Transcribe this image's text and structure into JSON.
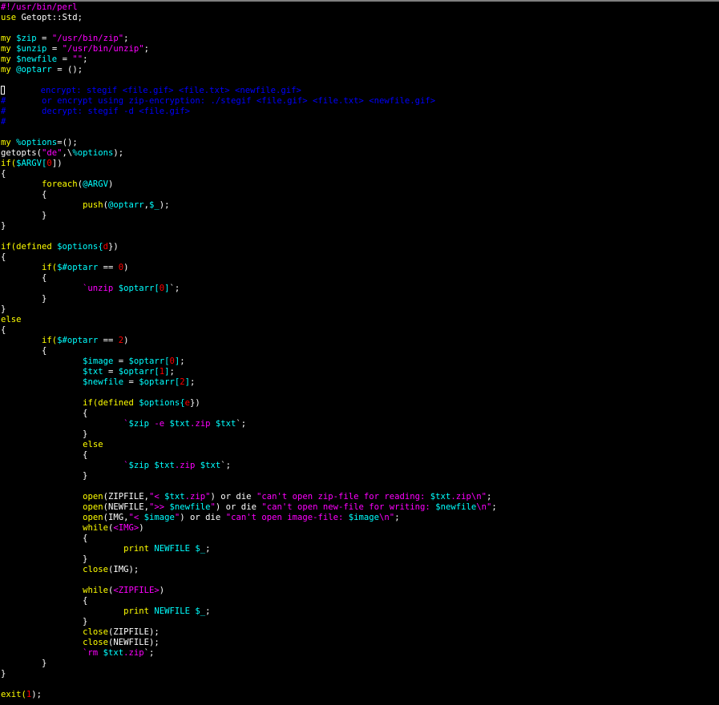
{
  "editor": {
    "palette": {
      "text": "#ffffff",
      "keyword": "#ffff00",
      "string": "#ff00ff",
      "comment": "#0000ff",
      "variable": "#00ffff",
      "number": "#ff0000",
      "builtin": "#00ffff"
    },
    "lines": [
      [
        {
          "t": "#!/usr/bin/perl",
          "c": "string"
        }
      ],
      [
        {
          "t": "use",
          "c": "keyword"
        },
        {
          "t": " Getopt::Std;",
          "c": "text"
        }
      ],
      [],
      [
        {
          "t": "my",
          "c": "keyword"
        },
        {
          "t": " ",
          "c": "text"
        },
        {
          "t": "$zip",
          "c": "variable"
        },
        {
          "t": " = ",
          "c": "text"
        },
        {
          "t": "\"/usr/bin/zip\"",
          "c": "string"
        },
        {
          "t": ";",
          "c": "text"
        }
      ],
      [
        {
          "t": "my",
          "c": "keyword"
        },
        {
          "t": " ",
          "c": "text"
        },
        {
          "t": "$unzip",
          "c": "variable"
        },
        {
          "t": " = ",
          "c": "text"
        },
        {
          "t": "\"/usr/bin/unzip\"",
          "c": "string"
        },
        {
          "t": ";",
          "c": "text"
        }
      ],
      [
        {
          "t": "my",
          "c": "keyword"
        },
        {
          "t": " ",
          "c": "text"
        },
        {
          "t": "$newfile",
          "c": "variable"
        },
        {
          "t": " = ",
          "c": "text"
        },
        {
          "t": "\"\"",
          "c": "string"
        },
        {
          "t": ";",
          "c": "text"
        }
      ],
      [
        {
          "t": "my",
          "c": "keyword"
        },
        {
          "t": " ",
          "c": "text"
        },
        {
          "t": "@optarr",
          "c": "variable"
        },
        {
          "t": " = ();",
          "c": "text"
        }
      ],
      [],
      [
        {
          "t": "#",
          "c": "cursor"
        },
        {
          "t": "\tencrypt: stegif <file.gif> <file.txt> <newfile.gif>",
          "c": "comment"
        }
      ],
      [
        {
          "t": "#\tor encrypt using zip-encryption: ./stegif <file.gif> <file.txt> <newfile.gif>",
          "c": "comment"
        }
      ],
      [
        {
          "t": "#\tdecrypt: stegif -d <file.gif>",
          "c": "comment"
        }
      ],
      [
        {
          "t": "#",
          "c": "comment"
        }
      ],
      [],
      [
        {
          "t": "my",
          "c": "keyword"
        },
        {
          "t": " ",
          "c": "text"
        },
        {
          "t": "%options",
          "c": "variable"
        },
        {
          "t": "=();",
          "c": "text"
        }
      ],
      [
        {
          "t": "getopts(",
          "c": "text"
        },
        {
          "t": "\"de\"",
          "c": "string"
        },
        {
          "t": ",\\",
          "c": "text"
        },
        {
          "t": "%options",
          "c": "variable"
        },
        {
          "t": ");",
          "c": "text"
        }
      ],
      [
        {
          "t": "if(",
          "c": "keyword"
        },
        {
          "t": "$ARGV[",
          "c": "variable"
        },
        {
          "t": "0",
          "c": "number"
        },
        {
          "t": "])",
          "c": "text"
        }
      ],
      [
        {
          "t": "{",
          "c": "text"
        }
      ],
      [
        {
          "t": "\t",
          "c": "text"
        },
        {
          "t": "foreach",
          "c": "keyword"
        },
        {
          "t": "(",
          "c": "text"
        },
        {
          "t": "@ARGV",
          "c": "variable"
        },
        {
          "t": ")",
          "c": "text"
        }
      ],
      [
        {
          "t": "\t{",
          "c": "text"
        }
      ],
      [
        {
          "t": "\t\t",
          "c": "text"
        },
        {
          "t": "push",
          "c": "keyword"
        },
        {
          "t": "(",
          "c": "text"
        },
        {
          "t": "@optarr",
          "c": "variable"
        },
        {
          "t": ",",
          "c": "text"
        },
        {
          "t": "$_",
          "c": "variable"
        },
        {
          "t": ");",
          "c": "text"
        }
      ],
      [
        {
          "t": "\t}",
          "c": "text"
        }
      ],
      [
        {
          "t": "}",
          "c": "text"
        }
      ],
      [],
      [
        {
          "t": "if(defined",
          "c": "keyword"
        },
        {
          "t": " ",
          "c": "text"
        },
        {
          "t": "$options{",
          "c": "variable"
        },
        {
          "t": "d",
          "c": "number"
        },
        {
          "t": "})",
          "c": "text"
        }
      ],
      [
        {
          "t": "{",
          "c": "text"
        }
      ],
      [
        {
          "t": "\t",
          "c": "text"
        },
        {
          "t": "if(",
          "c": "keyword"
        },
        {
          "t": "$#optarr",
          "c": "variable"
        },
        {
          "t": " == ",
          "c": "text"
        },
        {
          "t": "0",
          "c": "number"
        },
        {
          "t": ")",
          "c": "text"
        }
      ],
      [
        {
          "t": "\t{",
          "c": "text"
        }
      ],
      [
        {
          "t": "\t\t`unzip ",
          "c": "string"
        },
        {
          "t": "$optarr[",
          "c": "variable"
        },
        {
          "t": "0",
          "c": "number"
        },
        {
          "t": "]",
          "c": "variable"
        },
        {
          "t": "`;",
          "c": "text"
        }
      ],
      [
        {
          "t": "\t}",
          "c": "text"
        }
      ],
      [
        {
          "t": "}",
          "c": "text"
        }
      ],
      [
        {
          "t": "else",
          "c": "keyword"
        }
      ],
      [
        {
          "t": "{",
          "c": "text"
        }
      ],
      [
        {
          "t": "\t",
          "c": "text"
        },
        {
          "t": "if(",
          "c": "keyword"
        },
        {
          "t": "$#optarr",
          "c": "variable"
        },
        {
          "t": " == ",
          "c": "text"
        },
        {
          "t": "2",
          "c": "number"
        },
        {
          "t": ")",
          "c": "text"
        }
      ],
      [
        {
          "t": "\t{",
          "c": "text"
        }
      ],
      [
        {
          "t": "\t\t",
          "c": "text"
        },
        {
          "t": "$image",
          "c": "variable"
        },
        {
          "t": " = ",
          "c": "text"
        },
        {
          "t": "$optarr[",
          "c": "variable"
        },
        {
          "t": "0",
          "c": "number"
        },
        {
          "t": "]",
          "c": "variable"
        },
        {
          "t": ";",
          "c": "text"
        }
      ],
      [
        {
          "t": "\t\t",
          "c": "text"
        },
        {
          "t": "$txt",
          "c": "variable"
        },
        {
          "t": " = ",
          "c": "text"
        },
        {
          "t": "$optarr[",
          "c": "variable"
        },
        {
          "t": "1",
          "c": "number"
        },
        {
          "t": "]",
          "c": "variable"
        },
        {
          "t": ";",
          "c": "text"
        }
      ],
      [
        {
          "t": "\t\t",
          "c": "text"
        },
        {
          "t": "$newfile",
          "c": "variable"
        },
        {
          "t": " = ",
          "c": "text"
        },
        {
          "t": "$optarr[",
          "c": "variable"
        },
        {
          "t": "2",
          "c": "number"
        },
        {
          "t": "]",
          "c": "variable"
        },
        {
          "t": ";",
          "c": "text"
        }
      ],
      [],
      [
        {
          "t": "\t\t",
          "c": "text"
        },
        {
          "t": "if(defined",
          "c": "keyword"
        },
        {
          "t": " ",
          "c": "text"
        },
        {
          "t": "$options{",
          "c": "variable"
        },
        {
          "t": "e",
          "c": "number"
        },
        {
          "t": "})",
          "c": "text"
        }
      ],
      [
        {
          "t": "\t\t{",
          "c": "text"
        }
      ],
      [
        {
          "t": "\t\t\t`",
          "c": "string"
        },
        {
          "t": "$zip",
          "c": "variable"
        },
        {
          "t": " -e ",
          "c": "string"
        },
        {
          "t": "$txt",
          "c": "variable"
        },
        {
          "t": ".zip ",
          "c": "string"
        },
        {
          "t": "$txt",
          "c": "variable"
        },
        {
          "t": "`;",
          "c": "text"
        }
      ],
      [
        {
          "t": "\t\t}",
          "c": "text"
        }
      ],
      [
        {
          "t": "\t\t",
          "c": "text"
        },
        {
          "t": "else",
          "c": "keyword"
        }
      ],
      [
        {
          "t": "\t\t{",
          "c": "text"
        }
      ],
      [
        {
          "t": "\t\t\t`",
          "c": "string"
        },
        {
          "t": "$zip",
          "c": "variable"
        },
        {
          "t": " ",
          "c": "string"
        },
        {
          "t": "$txt",
          "c": "variable"
        },
        {
          "t": ".zip ",
          "c": "string"
        },
        {
          "t": "$txt",
          "c": "variable"
        },
        {
          "t": "`;",
          "c": "text"
        }
      ],
      [
        {
          "t": "\t\t}",
          "c": "text"
        }
      ],
      [],
      [
        {
          "t": "\t\t",
          "c": "text"
        },
        {
          "t": "open",
          "c": "keyword"
        },
        {
          "t": "(ZIPFILE,",
          "c": "text"
        },
        {
          "t": "\"< ",
          "c": "string"
        },
        {
          "t": "$txt",
          "c": "variable"
        },
        {
          "t": ".zip\"",
          "c": "string"
        },
        {
          "t": ") or die ",
          "c": "text"
        },
        {
          "t": "\"can't open zip-file for reading: ",
          "c": "string"
        },
        {
          "t": "$txt",
          "c": "variable"
        },
        {
          "t": ".zip\\n\"",
          "c": "string"
        },
        {
          "t": ";",
          "c": "text"
        }
      ],
      [
        {
          "t": "\t\t",
          "c": "text"
        },
        {
          "t": "open",
          "c": "keyword"
        },
        {
          "t": "(NEWFILE,",
          "c": "text"
        },
        {
          "t": "\">> ",
          "c": "string"
        },
        {
          "t": "$newfile",
          "c": "variable"
        },
        {
          "t": "\"",
          "c": "string"
        },
        {
          "t": ") or die ",
          "c": "text"
        },
        {
          "t": "\"can't open new-file for writing: ",
          "c": "string"
        },
        {
          "t": "$newfile",
          "c": "variable"
        },
        {
          "t": "\\n\"",
          "c": "string"
        },
        {
          "t": ";",
          "c": "text"
        }
      ],
      [
        {
          "t": "\t\t",
          "c": "text"
        },
        {
          "t": "open",
          "c": "keyword"
        },
        {
          "t": "(IMG,",
          "c": "text"
        },
        {
          "t": "\"< ",
          "c": "string"
        },
        {
          "t": "$image",
          "c": "variable"
        },
        {
          "t": "\"",
          "c": "string"
        },
        {
          "t": ") or die ",
          "c": "text"
        },
        {
          "t": "\"can't open image-file: ",
          "c": "string"
        },
        {
          "t": "$image",
          "c": "variable"
        },
        {
          "t": "\\n\"",
          "c": "string"
        },
        {
          "t": ";",
          "c": "text"
        }
      ],
      [
        {
          "t": "\t\t",
          "c": "text"
        },
        {
          "t": "while",
          "c": "keyword"
        },
        {
          "t": "(",
          "c": "text"
        },
        {
          "t": "<IMG>",
          "c": "string"
        },
        {
          "t": ")",
          "c": "text"
        }
      ],
      [
        {
          "t": "\t\t{",
          "c": "text"
        }
      ],
      [
        {
          "t": "\t\t\t",
          "c": "text"
        },
        {
          "t": "print",
          "c": "keyword"
        },
        {
          "t": " ",
          "c": "text"
        },
        {
          "t": "NEWFILE",
          "c": "variable"
        },
        {
          "t": " ",
          "c": "text"
        },
        {
          "t": "$_",
          "c": "variable"
        },
        {
          "t": ";",
          "c": "text"
        }
      ],
      [
        {
          "t": "\t\t}",
          "c": "text"
        }
      ],
      [
        {
          "t": "\t\t",
          "c": "text"
        },
        {
          "t": "close",
          "c": "keyword"
        },
        {
          "t": "(IMG);",
          "c": "text"
        }
      ],
      [],
      [
        {
          "t": "\t\t",
          "c": "text"
        },
        {
          "t": "while",
          "c": "keyword"
        },
        {
          "t": "(",
          "c": "text"
        },
        {
          "t": "<ZIPFILE>",
          "c": "string"
        },
        {
          "t": ")",
          "c": "text"
        }
      ],
      [
        {
          "t": "\t\t{",
          "c": "text"
        }
      ],
      [
        {
          "t": "\t\t\t",
          "c": "text"
        },
        {
          "t": "print",
          "c": "keyword"
        },
        {
          "t": " ",
          "c": "text"
        },
        {
          "t": "NEWFILE",
          "c": "variable"
        },
        {
          "t": " ",
          "c": "text"
        },
        {
          "t": "$_",
          "c": "variable"
        },
        {
          "t": ";",
          "c": "text"
        }
      ],
      [
        {
          "t": "\t\t}",
          "c": "text"
        }
      ],
      [
        {
          "t": "\t\t",
          "c": "text"
        },
        {
          "t": "close",
          "c": "keyword"
        },
        {
          "t": "(ZIPFILE);",
          "c": "text"
        }
      ],
      [
        {
          "t": "\t\t",
          "c": "text"
        },
        {
          "t": "close",
          "c": "keyword"
        },
        {
          "t": "(NEWFILE);",
          "c": "text"
        }
      ],
      [
        {
          "t": "\t\t`rm ",
          "c": "string"
        },
        {
          "t": "$txt",
          "c": "variable"
        },
        {
          "t": ".zip",
          "c": "string"
        },
        {
          "t": "`;",
          "c": "text"
        }
      ],
      [
        {
          "t": "\t}",
          "c": "text"
        }
      ],
      [
        {
          "t": "}",
          "c": "text"
        }
      ],
      [],
      [
        {
          "t": "exit(",
          "c": "keyword"
        },
        {
          "t": "1",
          "c": "number"
        },
        {
          "t": ");",
          "c": "text"
        }
      ]
    ]
  }
}
